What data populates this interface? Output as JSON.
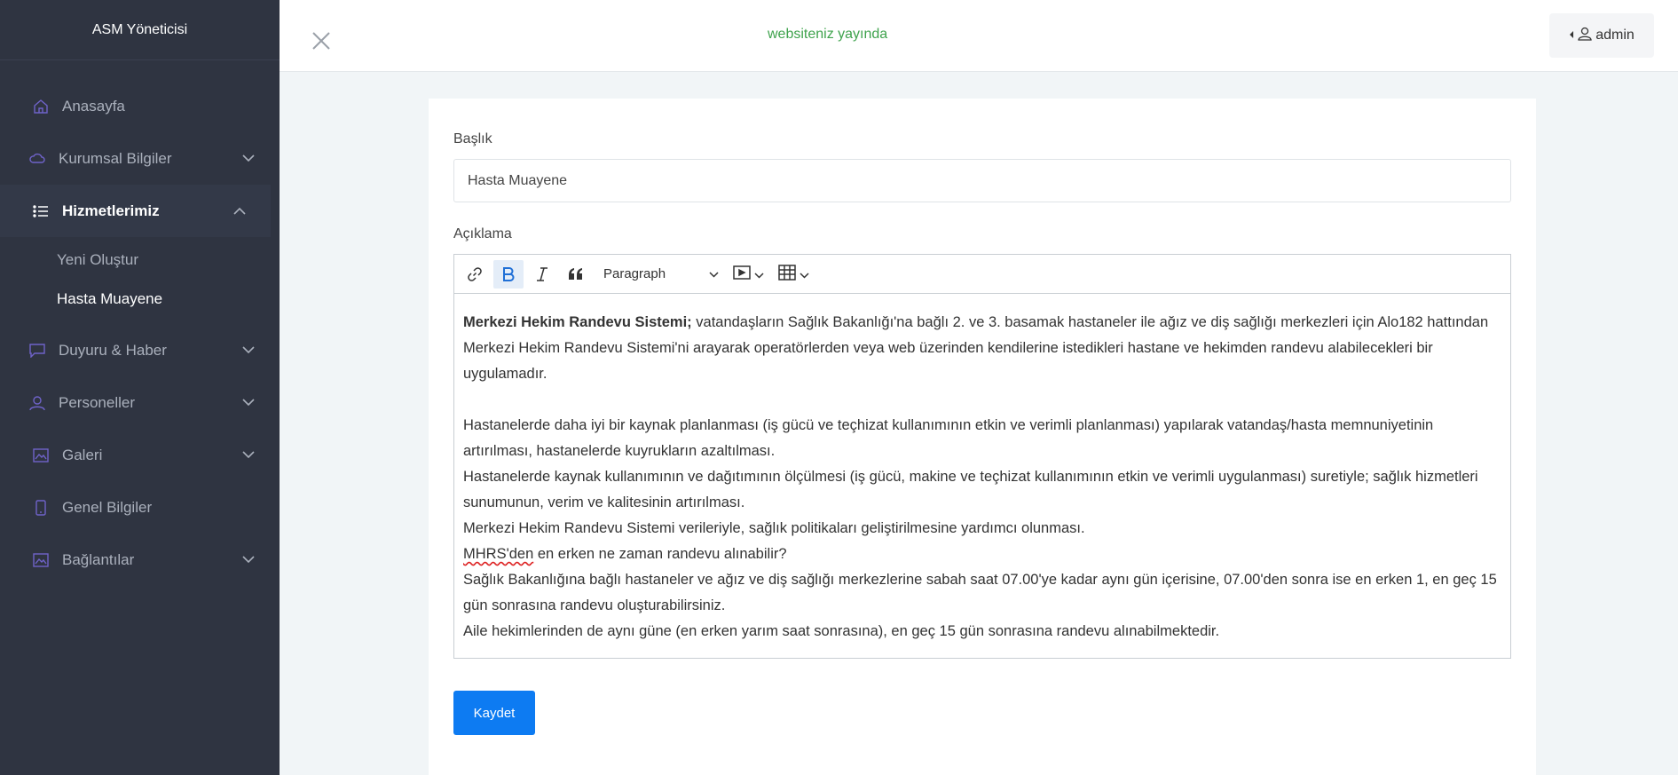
{
  "sidebar": {
    "brand": "ASM Yöneticisi",
    "items": [
      {
        "label": "Anasayfa",
        "icon": "home-icon",
        "has_children": false
      },
      {
        "label": "Kurumsal Bilgiler",
        "icon": "cloud-icon",
        "has_children": true
      },
      {
        "label": "Hizmetlerimiz",
        "icon": "list-icon",
        "has_children": true,
        "expanded": true
      },
      {
        "label": "Duyuru & Haber",
        "icon": "chat-icon",
        "has_children": true
      },
      {
        "label": "Personeller",
        "icon": "user-icon",
        "has_children": true
      },
      {
        "label": "Galeri",
        "icon": "image-icon",
        "has_children": true
      },
      {
        "label": "Genel Bilgiler",
        "icon": "phone-icon",
        "has_children": false
      },
      {
        "label": "Bağlantılar",
        "icon": "image-icon",
        "has_children": true
      }
    ],
    "subitems": [
      "Yeni Oluştur",
      "Hasta Muayene"
    ]
  },
  "header": {
    "status": "websiteniz yayında",
    "user": "admin"
  },
  "form": {
    "title_label": "Başlık",
    "title_value": "Hasta Muayene",
    "desc_label": "Açıklama",
    "paragraph_select": "Paragraph",
    "save_label": "Kaydet"
  },
  "content": {
    "p1_bold": "Merkezi Hekim Randevu Sistemi;",
    "p1_rest": " vatandaşların Sağlık Bakanlığı'na bağlı 2. ve 3. basamak hastaneler ile ağız ve diş sağlığı merkezleri için Alo182 hattından Merkezi Hekim Randevu Sistemi'ni arayarak  operatörlerden veya web üzerinden kendilerine istedikleri hastane ve hekimden randevu alabilecekleri bir uygulamadır.",
    "p2": "Hastanelerde daha iyi bir kaynak planlanması (iş gücü ve teçhizat kullanımının etkin ve verimli planlanması) yapılarak vatandaş/hasta memnuniyetinin artırılması, hastanelerde kuyrukların azaltılması.",
    "p3": "Hastanelerde kaynak kullanımının ve dağıtımının ölçülmesi (iş gücü, makine ve teçhizat kullanımının etkin ve verimli uygulanması) suretiyle; sağlık hizmetleri sunumunun, verim ve kalitesinin artırılması.",
    "p4": "Merkezi Hekim Randevu Sistemi verileriyle, sağlık politikaları geliştirilmesine yardımcı olunması.",
    "p5_spell": "MHRS'den",
    "p5_rest": " en erken ne zaman randevu alınabilir?",
    "p6": "Sağlık Bakanlığına bağlı hastaneler ve ağız ve diş sağlığı merkezlerine sabah saat 07.00'ye kadar aynı gün içerisine, 07.00'den sonra ise en erken 1, en geç 15 gün sonrasına randevu oluşturabilirsiniz.",
    "p7": "Aile hekimlerinden de aynı güne (en erken yarım saat sonrasına), en geç 15 gün sonrasına randevu alınabilmektedir."
  }
}
